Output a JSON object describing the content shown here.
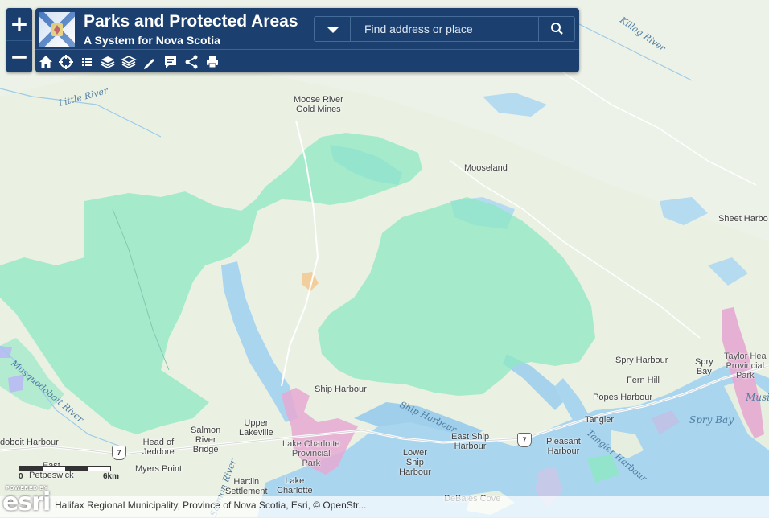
{
  "app": {
    "title": "Parks and Protected Areas",
    "subtitle": "A System for Nova Scotia"
  },
  "search": {
    "placeholder": "Find address or place",
    "value": ""
  },
  "zoom": {
    "in_label": "+",
    "out_label": "−"
  },
  "toolbar": {
    "tools": [
      "home-icon",
      "locate-icon",
      "legend-list-icon",
      "layers-icon",
      "basemap-layers-icon",
      "measure-pencil-icon",
      "details-comment-icon",
      "share-icon",
      "print-icon"
    ]
  },
  "scale": {
    "unit_label": "6km",
    "zero_label": "0"
  },
  "attribution": {
    "powered_by": "POWERED BY",
    "esri_logo": "esri",
    "text": "Halifax Regional Municipality, Province of Nova Scotia, Esri, © OpenStr..."
  },
  "places": {
    "moose_river": "Moose River\nGold Mines",
    "mooseland": "Mooseland",
    "sheet_harbour": "Sheet Harbo",
    "spry_harbour": "Spry Harbour",
    "fern_hill": "Fern Hill",
    "popes_harbour": "Popes Harbour",
    "spry_bay_town": "Spry\nBay",
    "taylor_head": "Taylor Hea\nProvincial\nPark",
    "ship_harbour": "Ship Harbour",
    "tangier": "Tangier",
    "east_ship_harbour": "East Ship\nHarbour",
    "pleasant_harbour": "Pleasant\nHarbour",
    "lower_ship_harbour": "Lower\nShip\nHarbour",
    "upper_lakeville": "Upper\nLakeville",
    "lake_charlotte_park": "Lake Charlotte\nProvincial\nPark",
    "salmon_river_bridge": "Salmon\nRiver\nBridge",
    "head_of_jeddore": "Head of\nJeddore",
    "myers_point": "Myers Point",
    "east_petpeswick": "East\nPetpeswick",
    "hartlin_settlement": "Hartlin\nSettlement",
    "lake_charlotte": "Lake\nCharlotte",
    "debaies_cove": "DeBaies Cove",
    "doboit_harbour": "doboit Harbour",
    "route_7a": "7",
    "route_7b": "7"
  },
  "water_labels": {
    "killag_river": "Killag River",
    "little_river": "Little River",
    "musquodoboit_river": "Musquodoboit River",
    "ship_harbour_water": "Ship Harbour",
    "tangier_harbour": "Tangier Harbour",
    "spry_bay": "Spry Bay",
    "musi": "Musi",
    "salmon_river": "Salmon River"
  },
  "colors": {
    "header_bg": "#1b3f6e",
    "land": "#e9f0e2",
    "protected_green": "#8ee8c3",
    "provincial_park_pink": "#e6a9d2",
    "water": "#a9d3ee",
    "road": "#ffffff"
  }
}
